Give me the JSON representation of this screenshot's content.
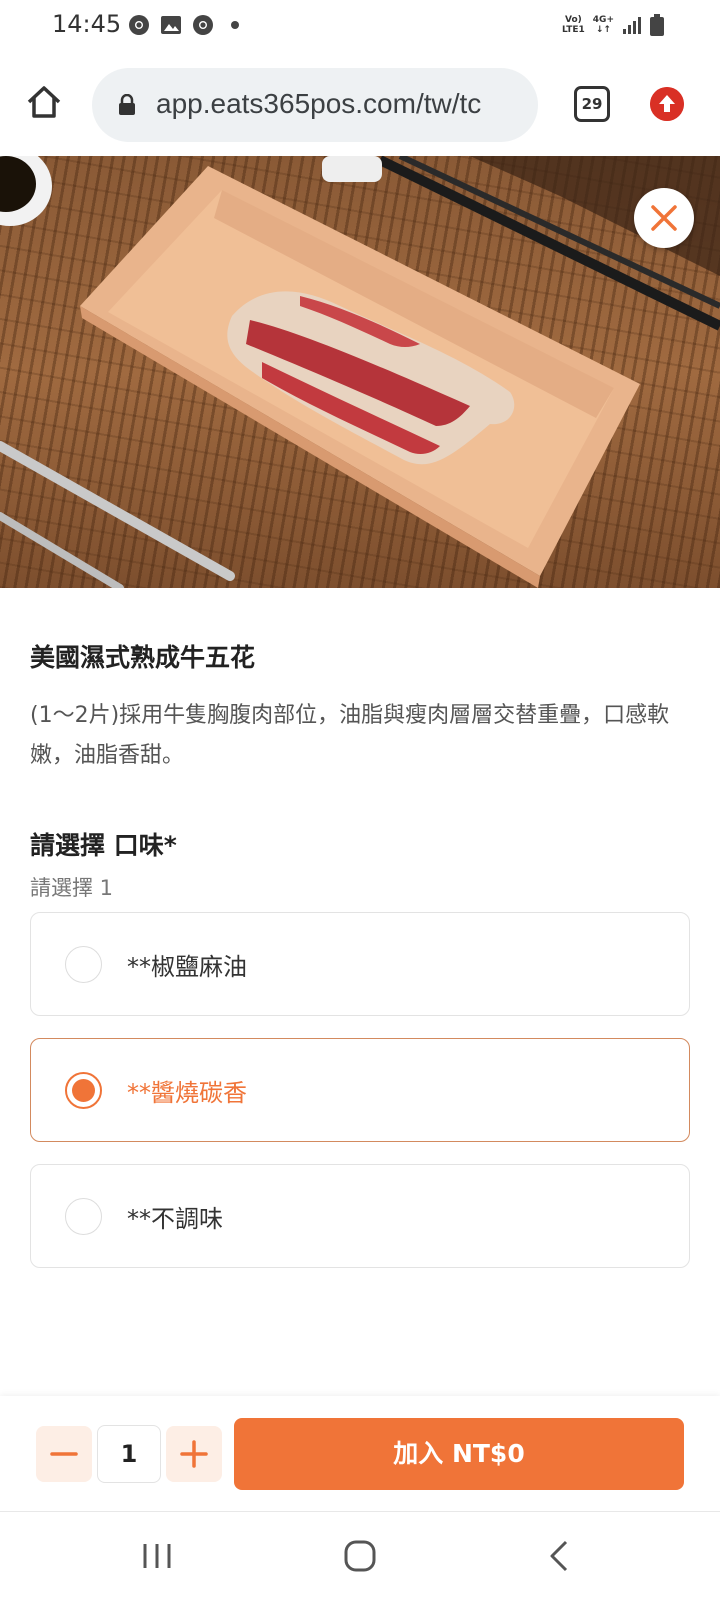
{
  "status_bar": {
    "time": "14:45",
    "icons": [
      "chrome-icon",
      "image-icon",
      "chrome-icon",
      "dot-icon"
    ],
    "network": "Vo) 4G+ LTE1",
    "signal": "signal-icon",
    "battery": "battery-icon"
  },
  "browser": {
    "url": "app.eats365pos.com/tw/tc",
    "tab_count": "29"
  },
  "item": {
    "title": "美國濕式熟成牛五花",
    "description": "(1～2片)採用牛隻胸腹肉部位，油脂與瘦肉層層交替重疊，口感軟嫩，油脂香甜。"
  },
  "option_group": {
    "title": "請選擇 口味*",
    "subtitle": "請選擇 1",
    "options": [
      {
        "label": "**椒鹽麻油",
        "selected": false
      },
      {
        "label": "**醬燒碳香",
        "selected": true
      },
      {
        "label": "**不調味",
        "selected": false
      }
    ]
  },
  "cart": {
    "quantity": "1",
    "add_label": "加入 NT$0"
  },
  "colors": {
    "accent": "#f07438",
    "accent_light": "#fdeee5",
    "selected_border": "#d38a5e"
  }
}
